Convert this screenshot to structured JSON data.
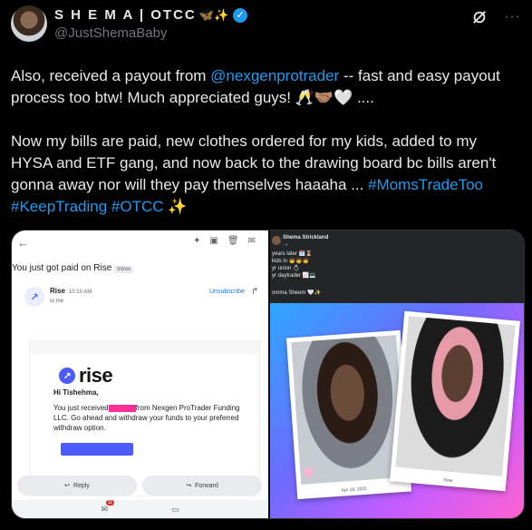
{
  "author": {
    "display_name": "S H E M A | OTCC",
    "display_name_emoji": "🦋✨",
    "verified_mark": "✓",
    "handle": "@JustShemaBaby"
  },
  "icons": {
    "grok": "grok-icon",
    "more": "more-icon"
  },
  "more_label": "···",
  "tweet": {
    "p1_before": "Also, received a payout from ",
    "p1_mention": "@nexgenprotrader",
    "p1_after": " -- fast and easy payout process too btw! Much appreciated guys! 🥂🤝🏽🤍 ....",
    "p2_before": "Now my bills are paid, new clothes ordered for my kids, added to my HYSA and ETF gang, and now back to the drawing board bc bills aren't gonna away nor will they pay themselves haaaha ... ",
    "p2_tag1": "#MomsTradeToo",
    "p2_tag2": "#KeepTrading",
    "p2_tag3": "#OTCC",
    "p2_end": " ✨"
  },
  "email": {
    "subject": "You just got paid on Rise",
    "inbox_chip": "Inbox",
    "sender": "Rise",
    "time": "10:10 AM",
    "to": "to me",
    "unsubscribe": "Unsubscribe",
    "logo_word": "rise",
    "greeting": "Hi Tishehma,",
    "body_start": "You just received",
    "body_rest": "from Nexgen ProTrader Funding LLC. Go ahead and withdraw your funds to your preferred withdraw option.",
    "reply": "Reply",
    "forward": "Forward",
    "badge": "11",
    "accent": "#4b5bff"
  },
  "social": {
    "name": "Shema Strickland",
    "lines": [
      "years later 🗓️⌛",
      "kids in 🧒🧒🧒",
      "yr union 💍",
      "yr daytrader 📈💻"
    ],
    "caption": "omma Sheem 🤍✨",
    "photo_left_label": "Apr 19, 2021",
    "photo_right_label": "Now"
  }
}
